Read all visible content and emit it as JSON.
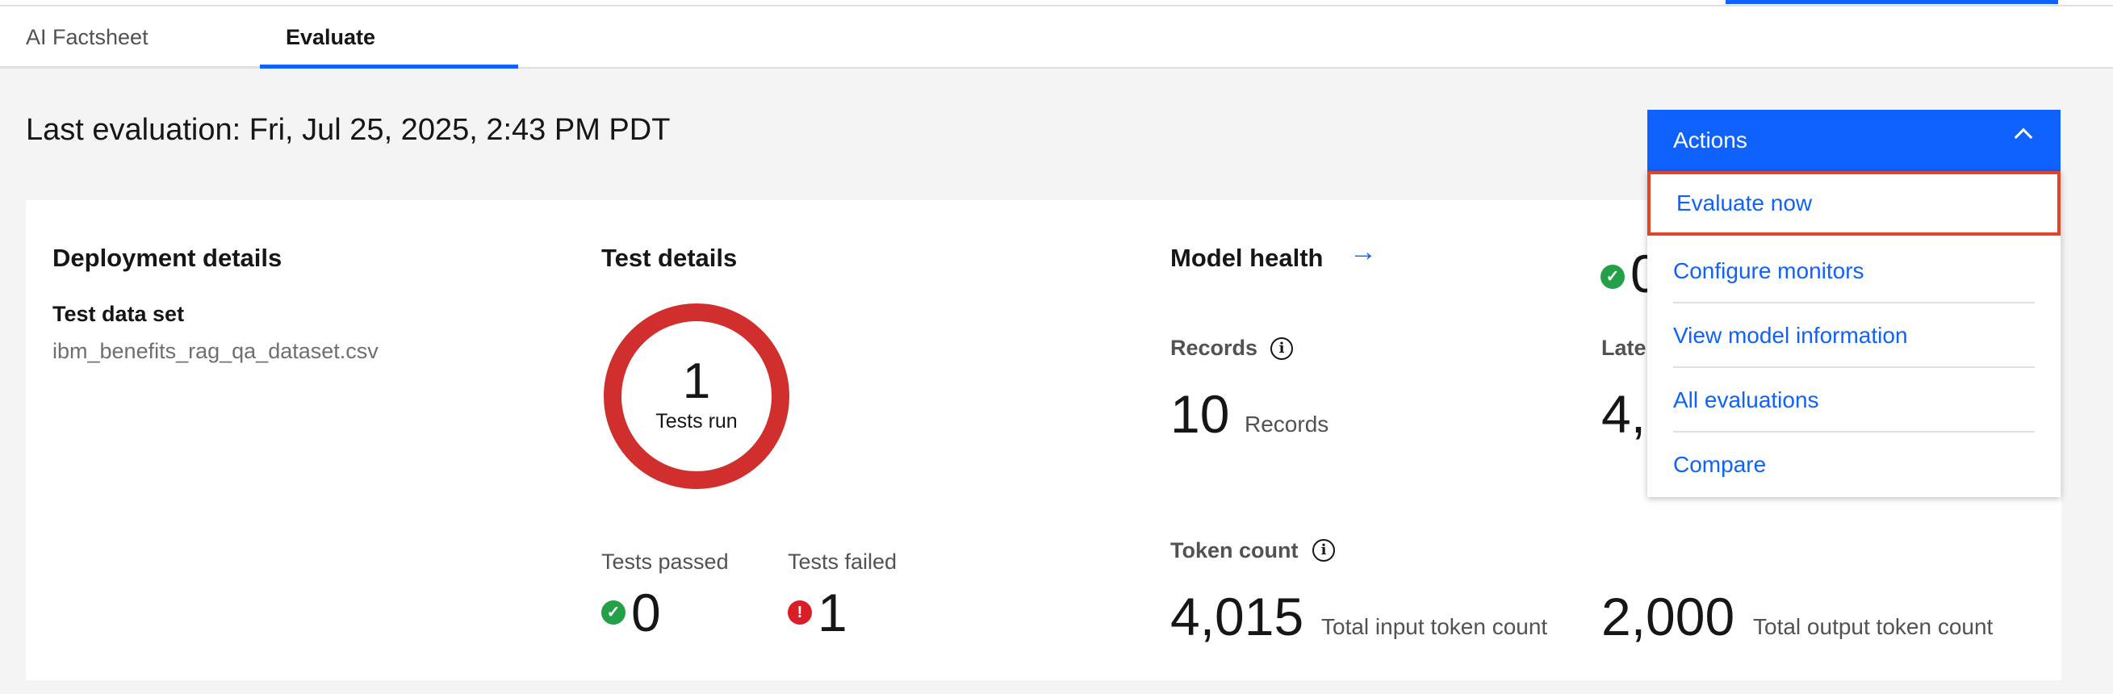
{
  "tabs": [
    {
      "label": "AI Factsheet"
    },
    {
      "label": "Evaluate"
    }
  ],
  "last_evaluation": "Last evaluation: Fri, Jul 25, 2025, 2:43 PM PDT",
  "deployment": {
    "title": "Deployment details",
    "test_data_label": "Test data set",
    "test_data_value": "ibm_benefits_rag_qa_dataset.csv"
  },
  "tests": {
    "title": "Test details",
    "run_count": "1",
    "run_label": "Tests run",
    "passed_label": "Tests passed",
    "passed_count": "0",
    "failed_label": "Tests failed",
    "failed_count": "1",
    "ring_color": "#d12e2e"
  },
  "model_health": {
    "title": "Model health",
    "records_label": "Records",
    "records_value": "10",
    "records_unit": "Records",
    "latency_label_partial": "Late",
    "latency_value_partial": "4,",
    "overall_value_partial": "0",
    "token_label": "Token count",
    "input_tokens": "4,015",
    "input_tokens_label": "Total input token count",
    "output_tokens": "2,000",
    "output_tokens_label": "Total output token count"
  },
  "actions": {
    "label": "Actions",
    "items": [
      {
        "label": "Evaluate now"
      },
      {
        "label": "Configure monitors"
      },
      {
        "label": "View model information"
      },
      {
        "label": "All evaluations"
      },
      {
        "label": "Compare"
      }
    ]
  },
  "colors": {
    "primary": "#0f62fe",
    "success": "#24a148",
    "error": "#da1e28",
    "focus_outline": "#e0452a"
  },
  "icons": {
    "check": "✓",
    "alert": "!",
    "info": "i",
    "arrow": "→"
  }
}
